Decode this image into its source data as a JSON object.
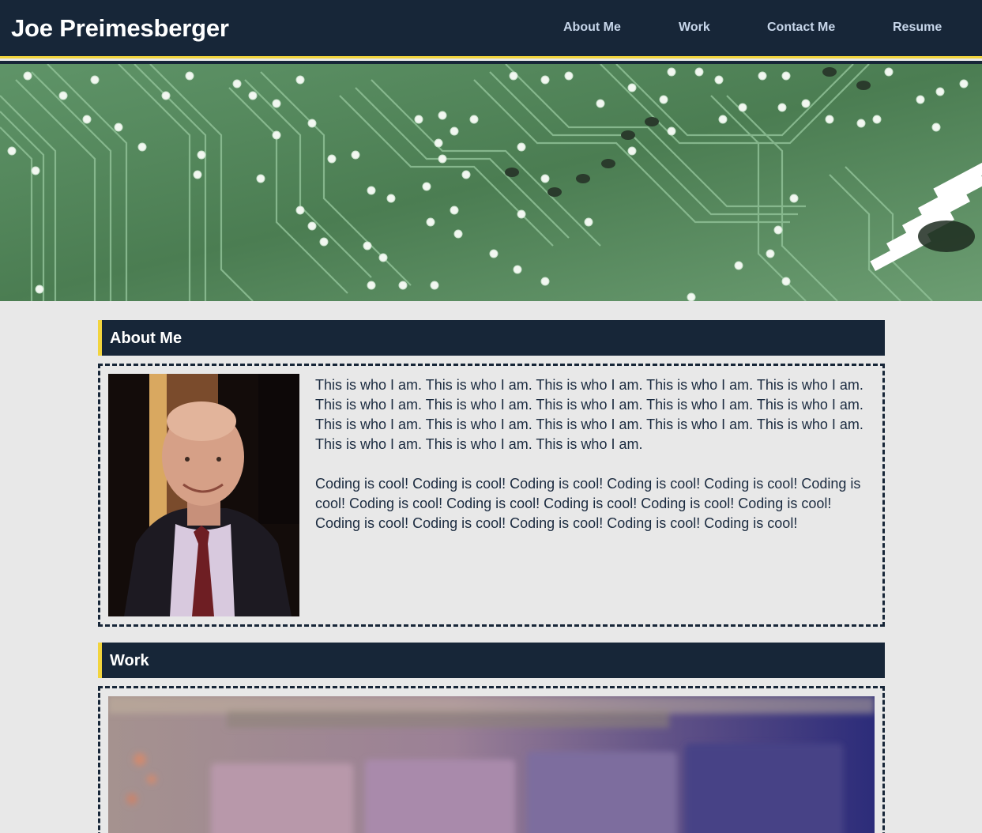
{
  "header": {
    "title": "Joe Preimesberger",
    "nav": [
      {
        "label": "About Me"
      },
      {
        "label": "Work"
      },
      {
        "label": "Contact Me"
      },
      {
        "label": "Resume"
      }
    ]
  },
  "about": {
    "heading": "About Me",
    "paragraph1": "This is who I am. This is who I am. This is who I am. This is who I am. This is who I am. This is who I am. This is who I am. This is who I am. This is who I am. This is who I am. This is who I am. This is who I am. This is who I am. This is who I am. This is who I am. This is who I am. This is who I am. This is who I am.",
    "paragraph2": "Coding is cool! Coding is cool! Coding is cool! Coding is cool! Coding is cool! Coding is cool! Coding is cool! Coding is cool! Coding is cool! Coding is cool! Coding is cool! Coding is cool! Coding is cool! Coding is cool! Coding is cool! Coding is cool!"
  },
  "work": {
    "heading": "Work"
  },
  "colors": {
    "navy": "#172638",
    "accent": "#f2d43d",
    "background": "#e8e8e8",
    "nav_text": "#c7d6ea"
  }
}
